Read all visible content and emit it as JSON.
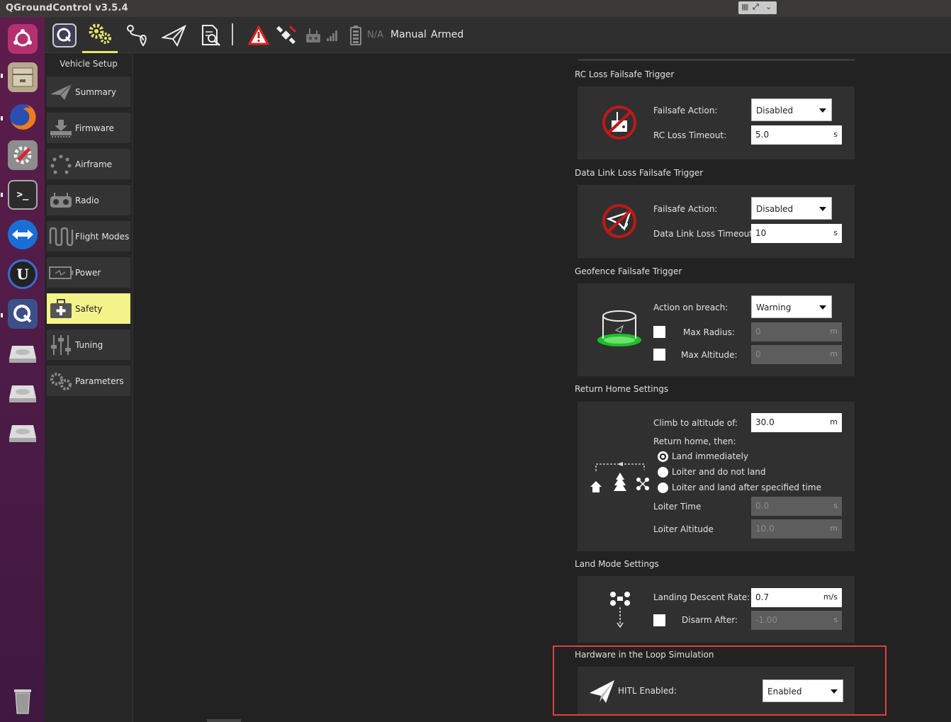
{
  "window": {
    "title": "QGroundControl v3.5.4"
  },
  "toolbar": {
    "battery_text": "N/A",
    "flight_mode": "Manual",
    "arm_state": "Armed"
  },
  "nav": {
    "title": "Vehicle Setup",
    "items": [
      {
        "label": "Summary",
        "icon": "plane-icon"
      },
      {
        "label": "Firmware",
        "icon": "firmware-download-icon"
      },
      {
        "label": "Airframe",
        "icon": "airframe-icon"
      },
      {
        "label": "Radio",
        "icon": "radio-icon"
      },
      {
        "label": "Flight Modes",
        "icon": "flight-modes-icon"
      },
      {
        "label": "Power",
        "icon": "power-icon"
      },
      {
        "label": "Safety",
        "icon": "safety-kit-icon",
        "active": true
      },
      {
        "label": "Tuning",
        "icon": "tuning-sliders-icon"
      },
      {
        "label": "Parameters",
        "icon": "parameters-gears-icon"
      }
    ]
  },
  "rc_loss": {
    "header": "RC Loss Failsafe Trigger",
    "action_label": "Failsafe Action:",
    "action_value": "Disabled",
    "timeout_label": "RC Loss Timeout:",
    "timeout_value": "5.0",
    "timeout_unit": "s"
  },
  "datalink_loss": {
    "header": "Data Link Loss Failsafe Trigger",
    "action_label": "Failsafe Action:",
    "action_value": "Disabled",
    "timeout_label": "Data Link Loss Timeout:",
    "timeout_value": "10",
    "timeout_unit": "s"
  },
  "geofence": {
    "header": "Geofence Failsafe Trigger",
    "action_label": "Action on breach:",
    "action_value": "Warning",
    "max_radius_label": "Max Radius:",
    "max_radius_value": "0",
    "max_radius_unit": "m",
    "max_altitude_label": "Max Altitude:",
    "max_altitude_value": "0",
    "max_altitude_unit": "m"
  },
  "return_home": {
    "header": "Return Home Settings",
    "climb_label": "Climb to altitude of:",
    "climb_value": "30.0",
    "climb_unit": "m",
    "then_label": "Return home, then:",
    "options": [
      "Land immediately",
      "Loiter and do not land",
      "Loiter and land after specified time"
    ],
    "loiter_time_label": "Loiter Time",
    "loiter_time_value": "0.0",
    "loiter_time_unit": "s",
    "loiter_alt_label": "Loiter Altitude",
    "loiter_alt_value": "10.0",
    "loiter_alt_unit": "m"
  },
  "land_mode": {
    "header": "Land Mode Settings",
    "descent_label": "Landing Descent Rate:",
    "descent_value": "0.7",
    "descent_unit": "m/s",
    "disarm_label": "Disarm After:",
    "disarm_value": "-1.00",
    "disarm_unit": "s"
  },
  "hitl": {
    "header": "Hardware in the Loop Simulation",
    "label": "HITL Enabled:",
    "value": "Enabled"
  },
  "colors": {
    "accent": "#f3f38a",
    "highlight_box": "#e04040",
    "warning": "#d92020"
  }
}
